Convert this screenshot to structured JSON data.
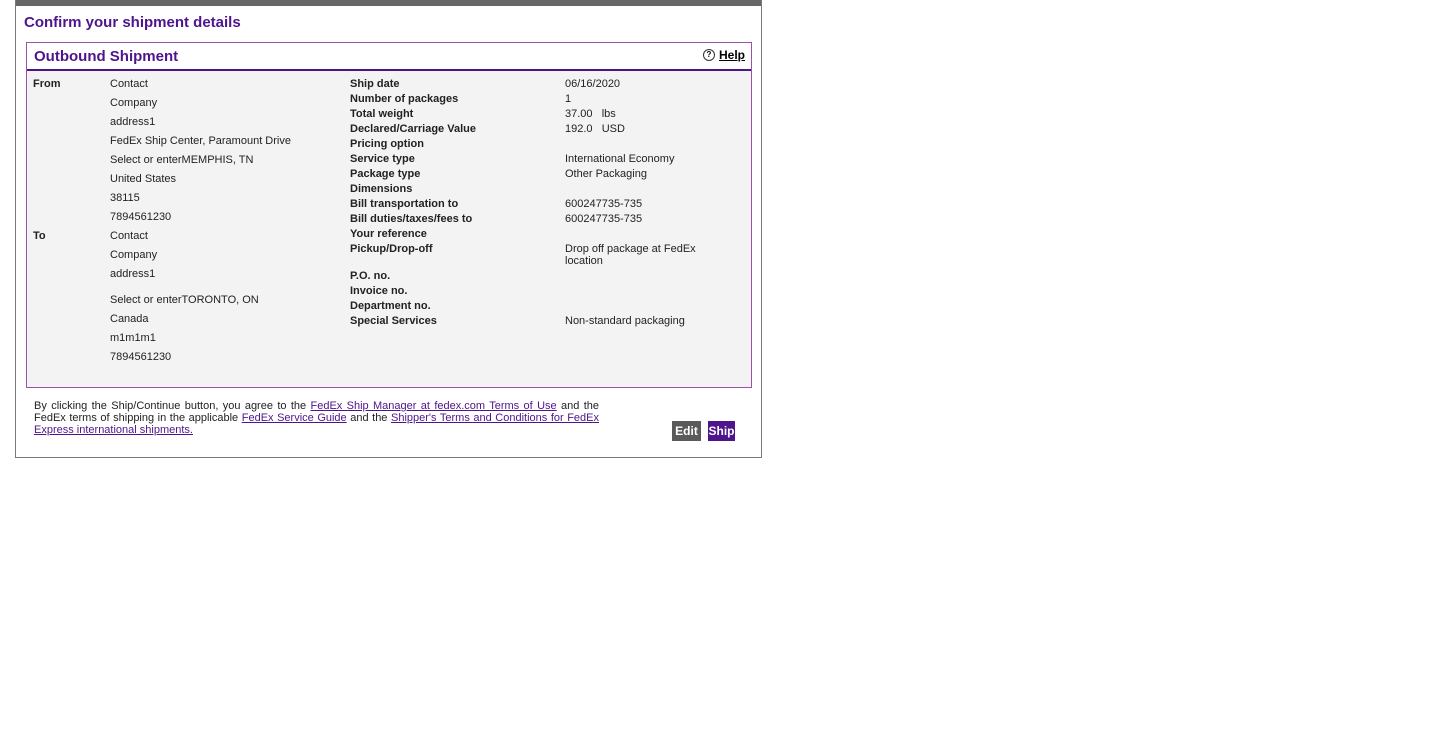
{
  "page": {
    "title": "Confirm your shipment details"
  },
  "panel": {
    "title": "Outbound Shipment",
    "help_label": "Help",
    "help_icon": "question-circle-icon"
  },
  "from": {
    "label": "From",
    "lines": [
      "Contact",
      "Company",
      "address1",
      "FedEx Ship Center, Paramount Drive",
      "Select or enterMEMPHIS, TN",
      "United States",
      "38115",
      "7894561230"
    ]
  },
  "to": {
    "label": "To",
    "lines": [
      "Contact",
      "Company",
      "address1",
      "Select or enterTORONTO, ON",
      "Canada",
      "m1m1m1",
      "7894561230"
    ]
  },
  "details": [
    {
      "label": "Ship date",
      "value": "06/16/2020"
    },
    {
      "label": "Number of packages",
      "value": "1"
    },
    {
      "label": "Total weight",
      "value": "37.00   lbs"
    },
    {
      "label": "Declared/Carriage Value",
      "value": "192.0   USD"
    },
    {
      "label": "Pricing option",
      "value": ""
    },
    {
      "label": "Service type",
      "value": "International Economy"
    },
    {
      "label": "Package type",
      "value": "Other Packaging"
    },
    {
      "label": "Dimensions",
      "value": ""
    },
    {
      "label": "Bill transportation to",
      "value": "600247735-735"
    },
    {
      "label": "Bill duties/taxes/fees to",
      "value": "600247735-735"
    },
    {
      "label": "Your reference",
      "value": ""
    },
    {
      "label": "Pickup/Drop-off",
      "value": "Drop off package at FedEx location"
    },
    {
      "label": "P.O. no.",
      "value": ""
    },
    {
      "label": "Invoice no.",
      "value": ""
    },
    {
      "label": "Department no.",
      "value": ""
    },
    {
      "label": "Special Services",
      "value": "Non-standard packaging"
    }
  ],
  "agreement": {
    "text1": "By clicking the Ship/Continue button, you agree to the ",
    "link1": "FedEx Ship Manager at fedex.com Terms of Use",
    "text2": " and the FedEx terms of shipping in the applicable ",
    "link2": "FedEx Service Guide",
    "text3": " and the ",
    "link3": "Shipper's Terms and Conditions for FedEx Express international shipments."
  },
  "buttons": {
    "edit": "Edit",
    "ship": "Ship"
  },
  "colors": {
    "brand_purple": "#4d148c",
    "panel_bg": "#f3f3f3",
    "edit_button": "#5a5a5a"
  }
}
